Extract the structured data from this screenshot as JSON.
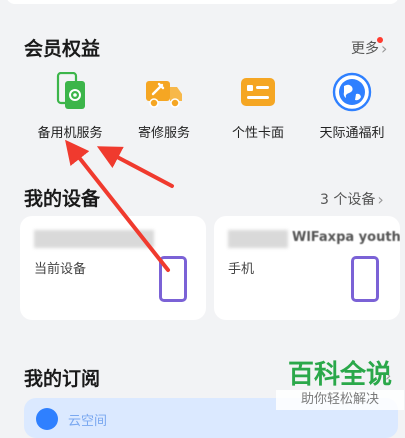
{
  "benefits": {
    "title": "会员权益",
    "more": "更多",
    "items": [
      {
        "label": "备用机服务",
        "icon": "backup-phone-icon"
      },
      {
        "label": "寄修服务",
        "icon": "delivery-truck-icon"
      },
      {
        "label": "个性卡面",
        "icon": "card-face-icon"
      },
      {
        "label": "天际通福利",
        "icon": "globe-icon"
      }
    ]
  },
  "devices": {
    "title": "我的设备",
    "count": "3 个设备",
    "cards": [
      {
        "name_fragment": "",
        "label": "当前设备"
      },
      {
        "name_fragment": "WlFaxpa youth",
        "label": "手机"
      }
    ]
  },
  "subscriptions": {
    "title": "我的订阅",
    "item": "云空间"
  },
  "watermark": {
    "main": "百科全说",
    "sub": "助你轻松解决"
  },
  "colors": {
    "accent_green": "#2aa84a",
    "icon_orange": "#f5a623",
    "icon_blue": "#2f80ff",
    "device_purple": "#7b62d6",
    "badge_red": "#ff3b30",
    "annotation_red": "#f03a2e"
  }
}
